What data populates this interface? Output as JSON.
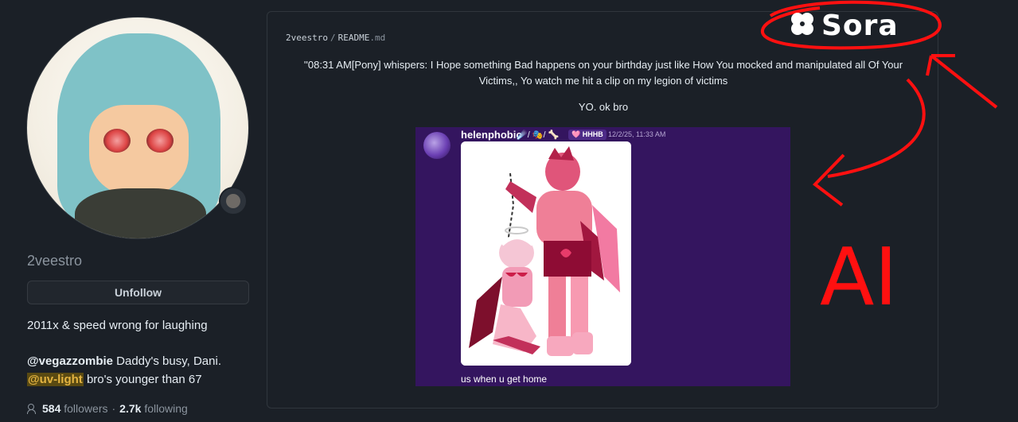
{
  "profile": {
    "username": "2veestro",
    "unfollow_label": "Unfollow",
    "bio": "2011x & speed wrong for laughing",
    "status_line1_mention": "@vegazzombie",
    "status_line1_text": " Daddy's busy, Dani.",
    "status_line2_mention": "@uv-light",
    "status_line2_text": " bro's younger than 67",
    "followers_count": "584",
    "followers_label": "followers",
    "dot": "·",
    "following_count": "2.7k",
    "following_label": "following"
  },
  "readme": {
    "owner": "2veestro",
    "separator": "/",
    "file_name": "README",
    "file_ext": ".md",
    "quote": "''08:31 AM[Pony] whispers: I Hope something Bad happens on your birthday just like How You mocked and manipulated all Of Your Victims,, Yo watch me hit a clip on my legion of victims",
    "reply": "YO. ok bro"
  },
  "discord": {
    "author": "helenphobic",
    "emojis": "☄️/ 🎭/ 🦴",
    "tag": "🩷 HHHB",
    "timestamp": "12/2/25, 11:33 AM",
    "message": "us when u get home"
  },
  "annotations": {
    "sora_label": "Sora",
    "ai_label": "AI",
    "annotation_color": "#ff1010"
  }
}
